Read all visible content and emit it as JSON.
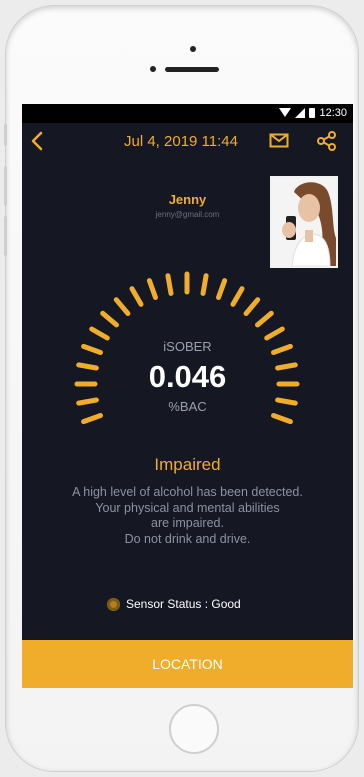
{
  "status_bar": {
    "time": "12:30"
  },
  "header": {
    "date": "Jul 4, 2019 11:44"
  },
  "user": {
    "name": "Jenny",
    "email": "jenny@gmail.com"
  },
  "gauge": {
    "brand": "iSOBER",
    "reading": "0.046",
    "unit": "%BAC"
  },
  "result": {
    "title": "Impaired",
    "message_lines": [
      "A high level of alcohol has been detected.",
      "Your physical and mental abilities",
      "are impaired.",
      "Do not drink and drive."
    ]
  },
  "sensor": {
    "label": "Sensor Status : Good"
  },
  "actions": {
    "location": "LOCATION"
  },
  "colors": {
    "accent": "#f0ad2b",
    "background": "#151823"
  }
}
